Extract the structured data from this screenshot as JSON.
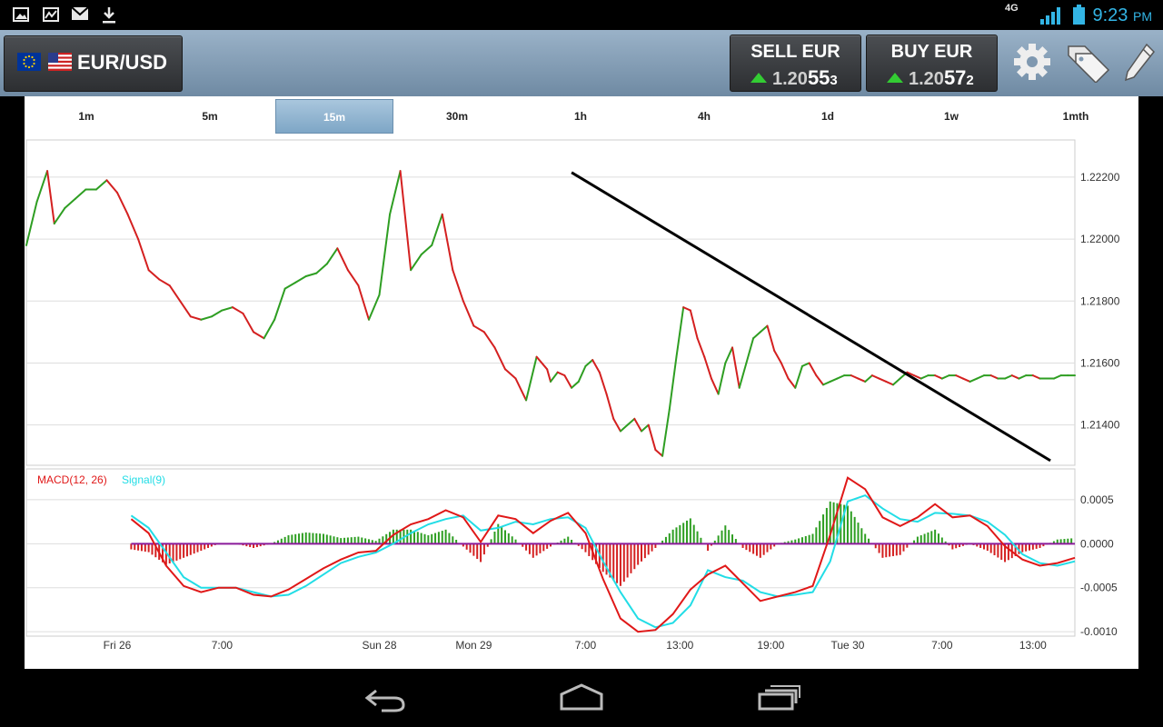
{
  "status": {
    "time": "9:23",
    "ampm": "PM",
    "network": "4G",
    "icons": [
      "gallery-icon",
      "picture-icon",
      "mail-icon",
      "download-icon",
      "signal-icon",
      "battery-icon"
    ]
  },
  "toolbar": {
    "pair": "EUR/USD",
    "sell": {
      "label": "SELL EUR",
      "price_prefix": "1.20",
      "price_big": "55",
      "price_small": "3"
    },
    "buy": {
      "label": "BUY EUR",
      "price_prefix": "1.20",
      "price_big": "57",
      "price_small": "2"
    },
    "colors": {
      "up_arrow": "#33cc33"
    }
  },
  "timeframes": [
    {
      "label": "1m",
      "active": false
    },
    {
      "label": "5m",
      "active": false
    },
    {
      "label": "15m",
      "active": true
    },
    {
      "label": "30m",
      "active": false
    },
    {
      "label": "1h",
      "active": false
    },
    {
      "label": "4h",
      "active": false
    },
    {
      "label": "1d",
      "active": false
    },
    {
      "label": "1w",
      "active": false
    },
    {
      "label": "1mth",
      "active": false
    }
  ],
  "chart_data": [
    {
      "type": "line",
      "title": "",
      "ylim": [
        1.2127,
        1.2232
      ],
      "y_ticks": [
        "1.22200",
        "1.22000",
        "1.21800",
        "1.21600",
        "1.21400"
      ],
      "x_ticks": [
        "Fri 26",
        "7:00",
        "Sun 28",
        "Mon 29",
        "7:00",
        "13:00",
        "19:00",
        "Tue 30",
        "7:00",
        "13:00"
      ],
      "grid": true,
      "colors": {
        "up": "#2e9e22",
        "down": "#d42020",
        "trendline": "#000000"
      },
      "x": [
        0,
        3,
        6,
        8,
        11,
        14,
        17,
        20,
        23,
        26,
        29,
        32,
        35,
        38,
        41,
        44,
        47,
        50,
        53,
        56,
        59,
        62,
        65,
        68,
        71,
        74,
        77,
        80,
        83,
        86,
        89,
        92,
        95,
        98,
        101,
        104,
        107,
        110,
        113,
        116,
        119,
        122,
        125,
        128,
        131,
        134,
        137,
        140,
        143,
        146,
        149,
        150,
        152,
        154,
        156,
        158,
        160,
        162,
        164,
        166,
        168,
        170,
        172,
        174,
        176,
        178,
        180,
        182,
        184,
        186,
        188,
        190,
        192,
        194,
        196,
        198,
        200,
        202,
        204,
        206,
        208,
        210,
        212,
        214,
        216,
        218,
        220,
        222,
        224,
        226,
        228,
        230,
        232,
        234,
        236,
        238,
        240,
        242,
        244,
        246,
        248,
        250,
        252,
        254,
        256,
        258,
        260,
        262,
        264,
        266,
        268,
        270,
        272,
        274,
        276,
        278,
        280,
        282,
        284,
        286,
        288,
        290,
        292,
        294,
        296,
        298,
        300
      ],
      "price": [
        1.2198,
        1.2212,
        1.2222,
        1.2205,
        1.221,
        1.2213,
        1.2216,
        1.2216,
        1.2219,
        1.2215,
        1.2208,
        1.22,
        1.219,
        1.2187,
        1.2185,
        1.218,
        1.2175,
        1.2174,
        1.2175,
        1.2177,
        1.2178,
        1.2176,
        1.217,
        1.2168,
        1.2174,
        1.2184,
        1.2186,
        1.2188,
        1.2189,
        1.2192,
        1.2197,
        1.219,
        1.2185,
        1.2174,
        1.2182,
        1.2208,
        1.2222,
        1.219,
        1.2195,
        1.2198,
        1.2208,
        1.219,
        1.218,
        1.2172,
        1.217,
        1.2165,
        1.2158,
        1.2155,
        1.2148,
        1.2162,
        1.2158,
        1.2154,
        1.2157,
        1.2156,
        1.2152,
        1.2154,
        1.2159,
        1.2161,
        1.2157,
        1.215,
        1.2142,
        1.2138,
        1.214,
        1.2142,
        1.2138,
        1.214,
        1.2132,
        1.213,
        1.2145,
        1.2162,
        1.2178,
        1.2177,
        1.2168,
        1.2162,
        1.2155,
        1.215,
        1.216,
        1.2165,
        1.2152,
        1.216,
        1.2168,
        1.217,
        1.2172,
        1.2164,
        1.216,
        1.2155,
        1.2152,
        1.2159,
        1.216,
        1.2156,
        1.2153,
        1.2154,
        1.2155,
        1.2156,
        1.2156,
        1.2155,
        1.2154,
        1.2156,
        1.2155,
        1.2154,
        1.2153,
        1.2155,
        1.2157,
        1.2156,
        1.2155,
        1.2156,
        1.2156,
        1.2155,
        1.2156,
        1.2156,
        1.2155,
        1.2154,
        1.2155,
        1.2156,
        1.2156,
        1.2155,
        1.2155,
        1.2156,
        1.2155,
        1.2156,
        1.2156,
        1.2155,
        1.2155,
        1.2155,
        1.2156,
        1.2156,
        1.2156
      ],
      "trendline": [
        [
          156,
          1.22215
        ],
        [
          293,
          1.21285
        ]
      ]
    },
    {
      "type": "bar",
      "title": "",
      "legend": [
        {
          "name": "MACD(12, 26)",
          "color": "#e01818"
        },
        {
          "name": "Signal(9)",
          "color": "#22dde6"
        }
      ],
      "ylim": [
        -0.00105,
        0.00085
      ],
      "y_ticks": [
        "0.0005",
        "0.0000",
        "-0.0005",
        "-0.0010"
      ],
      "zero_line_color": "#8a1a9a",
      "hist_colors": {
        "pos": "#2e9e22",
        "neg": "#d42020"
      },
      "x": [
        30,
        35,
        40,
        45,
        50,
        55,
        60,
        65,
        70,
        75,
        80,
        85,
        90,
        95,
        100,
        105,
        110,
        115,
        120,
        125,
        130,
        135,
        140,
        145,
        150,
        155,
        160,
        165,
        170,
        175,
        180,
        185,
        190,
        195,
        200,
        205,
        210,
        215,
        220,
        225,
        230,
        235,
        240,
        245,
        250,
        255,
        260,
        265,
        270,
        275,
        280,
        285,
        290,
        295,
        300
      ],
      "macd": [
        0.00028,
        0.00012,
        -0.00025,
        -0.00048,
        -0.00055,
        -0.0005,
        -0.0005,
        -0.00058,
        -0.0006,
        -0.00052,
        -0.0004,
        -0.00028,
        -0.00018,
        -0.0001,
        -8e-05,
        0.0001,
        0.00022,
        0.00028,
        0.00038,
        0.0003,
        2e-05,
        0.00032,
        0.00028,
        0.00012,
        0.00026,
        0.00035,
        0.00012,
        -0.0004,
        -0.00085,
        -0.001,
        -0.00098,
        -0.0008,
        -0.00052,
        -0.00035,
        -0.00025,
        -0.00045,
        -0.00065,
        -0.0006,
        -0.00055,
        -0.00048,
        0.0001,
        0.00075,
        0.00062,
        0.0003,
        0.0002,
        0.0003,
        0.00045,
        0.0003,
        0.00032,
        0.0002,
        -3e-05,
        -0.00018,
        -0.00025,
        -0.00022,
        -0.00016
      ],
      "signal": [
        0.00032,
        0.00018,
        -0.0001,
        -0.00038,
        -0.0005,
        -0.0005,
        -0.0005,
        -0.00055,
        -0.0006,
        -0.00058,
        -0.00048,
        -0.00035,
        -0.00022,
        -0.00015,
        -0.0001,
        0.0,
        0.00012,
        0.00022,
        0.00028,
        0.00032,
        0.00015,
        0.00018,
        0.00025,
        0.00022,
        0.00028,
        0.0003,
        0.00018,
        -0.0002,
        -0.00055,
        -0.00085,
        -0.00095,
        -0.0009,
        -0.0007,
        -0.0003,
        -0.00038,
        -0.00042,
        -0.00055,
        -0.0006,
        -0.00058,
        -0.00055,
        -0.0002,
        0.00048,
        0.00055,
        0.0004,
        0.00028,
        0.00025,
        0.00035,
        0.00034,
        0.00032,
        0.00025,
        0.0001,
        -0.00012,
        -0.00022,
        -0.00025,
        -0.0002
      ]
    }
  ]
}
